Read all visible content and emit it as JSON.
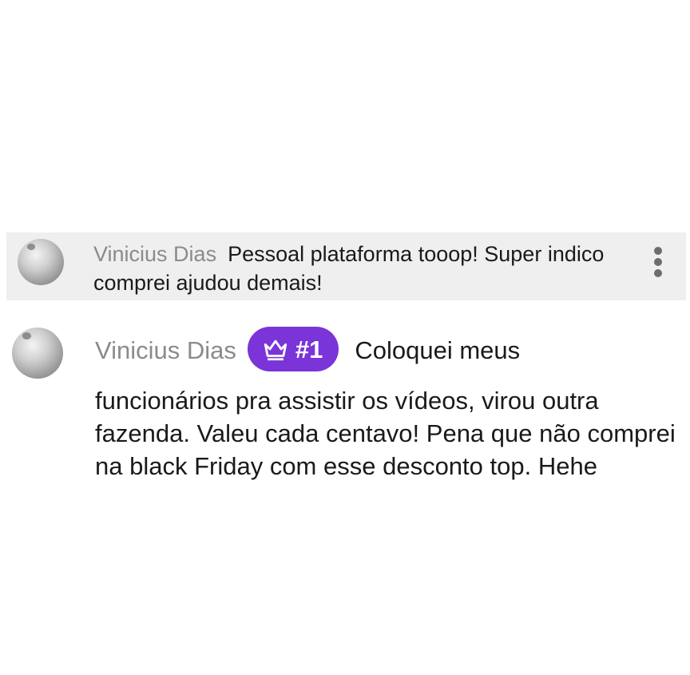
{
  "messages": [
    {
      "author": "Vinicius Dias",
      "text": "Pessoal plataforma tooop! Super indico comprei ajudou demais!",
      "highlighted": true,
      "menu_icon": "more-vert-icon"
    },
    {
      "author": "Vinicius Dias",
      "badge": {
        "icon": "crown-icon",
        "label": "#1",
        "color": "#7a34d8"
      },
      "text_first": "Coloquei meus",
      "text_rest": "funcionários pra assistir os vídeos, virou outra fazenda. Valeu cada centavo! Pena que não comprei na black Friday com esse desconto top. Hehe"
    }
  ],
  "colors": {
    "highlight_row": "#efefef",
    "author": "#8b8b8b",
    "text": "#1a1a1a"
  }
}
